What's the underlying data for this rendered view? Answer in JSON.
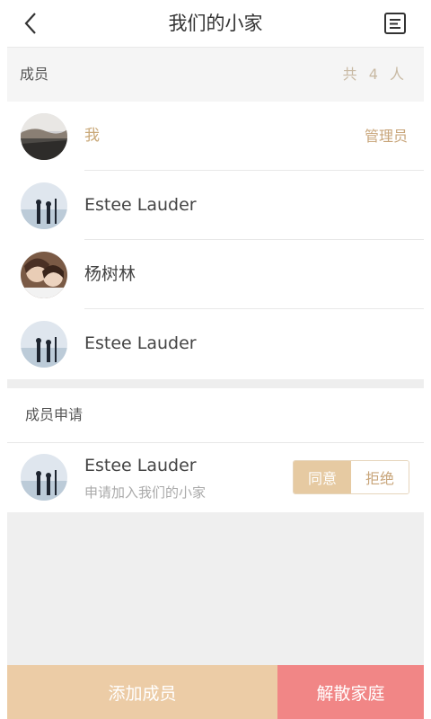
{
  "header": {
    "title": "我们的小家"
  },
  "members_section": {
    "label": "成员",
    "count": "共 4 人"
  },
  "members": [
    {
      "name": "我",
      "role": "管理员",
      "avatar": "landscape-avatar",
      "self": true
    },
    {
      "name": "Estee Lauder",
      "role": "",
      "avatar": "beach-silhouette-avatar"
    },
    {
      "name": "杨树林",
      "role": "",
      "avatar": "couple-photo-avatar"
    },
    {
      "name": "Estee Lauder",
      "role": "",
      "avatar": "beach-silhouette-avatar"
    }
  ],
  "requests_section": {
    "label": "成员申请"
  },
  "requests": [
    {
      "name": "Estee Lauder",
      "message": "申请加入我们的小家",
      "agree_label": "同意",
      "reject_label": "拒绝",
      "avatar": "beach-silhouette-avatar"
    }
  ],
  "footer": {
    "add_label": "添加成员",
    "dissolve_label": "解散家庭"
  },
  "colors": {
    "accent": "#e6caa2",
    "danger": "#f18686",
    "role_text": "#c8a57a"
  }
}
